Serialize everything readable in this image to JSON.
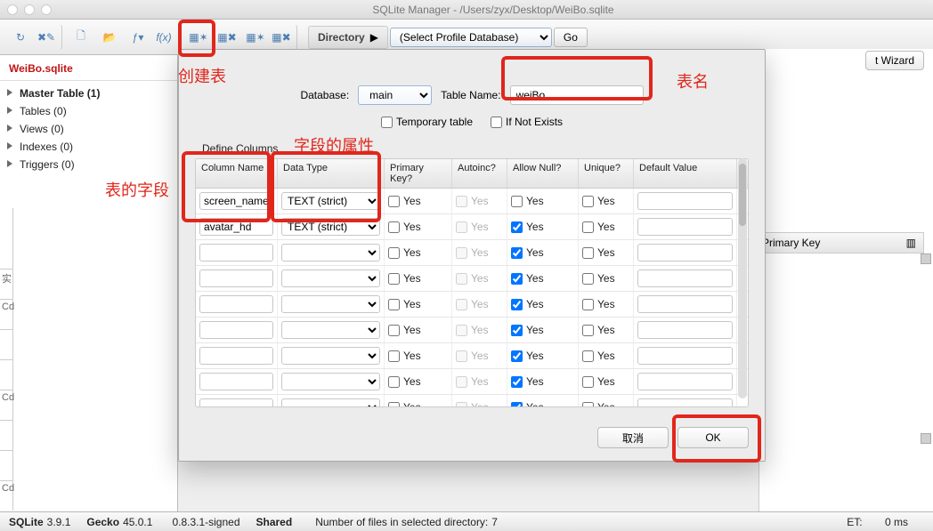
{
  "window": {
    "title": "SQLite Manager - /Users/zyx/Desktop/WeiBo.sqlite"
  },
  "toolbar": {
    "directory_label": "Directory",
    "profile_options": [
      "(Select Profile Database)"
    ],
    "go_label": "Go"
  },
  "sidebar": {
    "dbfile": "WeiBo.sqlite",
    "items": [
      {
        "label": "Master Table (1)",
        "selected": true
      },
      {
        "label": "Tables (0)",
        "selected": false
      },
      {
        "label": "Views (0)",
        "selected": false
      },
      {
        "label": "Indexes (0)",
        "selected": false
      },
      {
        "label": "Triggers (0)",
        "selected": false
      }
    ],
    "stubs": [
      "",
      "Cd",
      "",
      "Cd",
      "",
      "",
      "Cd"
    ]
  },
  "dialog": {
    "database_label": "Database:",
    "database_options": [
      "main"
    ],
    "tablename_label": "Table Name:",
    "tablename_value": "weiBo",
    "temporary_label": "Temporary table",
    "temporary_checked": false,
    "ifnotexists_label": "If Not Exists",
    "ifnotexists_checked": false,
    "define_columns_label": "Define Columns",
    "headers": {
      "name": "Column Name",
      "type": "Data Type",
      "pk": "Primary Key?",
      "ai": "Autoinc?",
      "null": "Allow Null?",
      "uniq": "Unique?",
      "def": "Default Value"
    },
    "yes": "Yes",
    "rows": [
      {
        "name": "screen_name",
        "type": "TEXT (strict)",
        "pk": false,
        "ai": false,
        "ai_disabled": true,
        "null_checked": false,
        "uniq": false,
        "def": ""
      },
      {
        "name": "avatar_hd",
        "type": "TEXT (strict)",
        "pk": false,
        "ai": false,
        "ai_disabled": true,
        "null_checked": true,
        "uniq": false,
        "def": ""
      },
      {
        "name": "",
        "type": "",
        "pk": false,
        "ai": false,
        "ai_disabled": true,
        "null_checked": true,
        "uniq": false,
        "def": ""
      },
      {
        "name": "",
        "type": "",
        "pk": false,
        "ai": false,
        "ai_disabled": true,
        "null_checked": true,
        "uniq": false,
        "def": ""
      },
      {
        "name": "",
        "type": "",
        "pk": false,
        "ai": false,
        "ai_disabled": true,
        "null_checked": true,
        "uniq": false,
        "def": ""
      },
      {
        "name": "",
        "type": "",
        "pk": false,
        "ai": false,
        "ai_disabled": true,
        "null_checked": true,
        "uniq": false,
        "def": ""
      },
      {
        "name": "",
        "type": "",
        "pk": false,
        "ai": false,
        "ai_disabled": true,
        "null_checked": true,
        "uniq": false,
        "def": ""
      },
      {
        "name": "",
        "type": "",
        "pk": false,
        "ai": false,
        "ai_disabled": true,
        "null_checked": true,
        "uniq": false,
        "def": ""
      },
      {
        "name": "",
        "type": "",
        "pk": false,
        "ai": false,
        "ai_disabled": true,
        "null_checked": true,
        "uniq": false,
        "def": ""
      },
      {
        "name": "",
        "type": "",
        "pk": false,
        "ai": false,
        "ai_disabled": true,
        "null_checked": true,
        "uniq": false,
        "def": ""
      }
    ],
    "cancel_label": "取消",
    "ok_label": "OK"
  },
  "right": {
    "wizard_button_fragment": "t Wizard",
    "primary_key_header": "Primary Key"
  },
  "status": {
    "sqlite_label": "SQLite",
    "sqlite_ver": "3.9.1",
    "gecko_label": "Gecko",
    "gecko_ver": "45.0.1",
    "ext_ver": "0.8.3.1-signed",
    "shared": "Shared",
    "files_label": "Number of files in selected directory:",
    "files_count": "7",
    "et_label": "ET:",
    "et_value": "0 ms"
  },
  "annotations": {
    "create_table": "创建表",
    "table_fields": "表的字段",
    "field_props": "字段的属性",
    "table_name": "表名"
  },
  "icons": {
    "refresh": "refresh-icon",
    "tools": "tools-icon",
    "newfile": "new-file-icon",
    "openfile": "open-file-icon",
    "fx": "function-icon",
    "fx2": "fx-icon",
    "newtable": "new-table-icon",
    "droptable": "drop-table-icon",
    "copytable": "copy-table-icon",
    "renametable": "rename-table-icon",
    "play": "play-icon"
  }
}
